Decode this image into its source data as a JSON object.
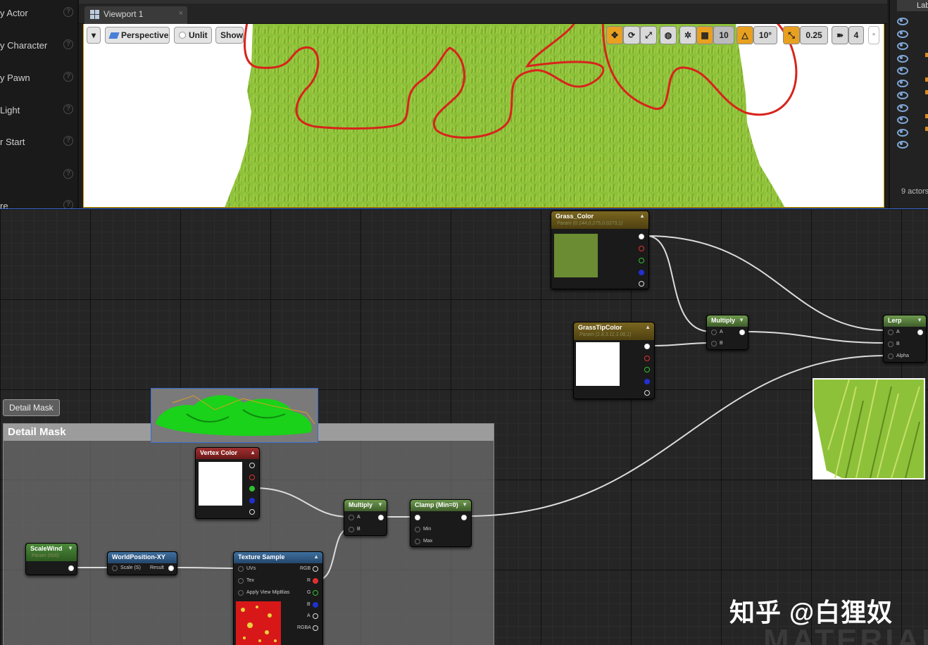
{
  "placement_panel": {
    "items": [
      {
        "label": "y Actor"
      },
      {
        "label": "y Character"
      },
      {
        "label": "y Pawn"
      },
      {
        "label": "Light"
      },
      {
        "label": "r Start"
      },
      {
        "label": ""
      },
      {
        "label": "re"
      }
    ],
    "help_glyph": "?"
  },
  "viewport_tab": {
    "label": "Viewport 1",
    "close_glyph": "×"
  },
  "viewport_toolbar": {
    "menu_glyph": "▾",
    "perspective": "Perspective",
    "unlit": "Unlit",
    "show": "Show",
    "grid_snap": "10",
    "rotation_snap": "10°",
    "scale_snap": "0.25",
    "camera_speed": "4"
  },
  "outliner": {
    "header": "Label",
    "actor_count": "9 actors"
  },
  "graph": {
    "comment": {
      "title": "Detail Mask",
      "bubble": "Detail Mask"
    },
    "nodes": {
      "grass_color": {
        "title": "Grass_Color",
        "subtitle": "Param (0.144,0.275,0.0273,1)",
        "swatch_color": "#6b8c33"
      },
      "grass_tip_color": {
        "title": "GrassTipColor",
        "subtitle": "Param (1.8,3.11,1.08,1)",
        "swatch_color": "#ffffff"
      },
      "multiply_top": {
        "title": "Multiply",
        "pin_a": "A",
        "pin_b": "B"
      },
      "lerp": {
        "title": "Lerp",
        "pin_a": "A",
        "pin_b": "B",
        "pin_alpha": "Alpha"
      },
      "vertex_color": {
        "title": "Vertex Color",
        "swatch_color": "#ffffff"
      },
      "multiply_bottom": {
        "title": "Multiply",
        "pin_a": "A",
        "pin_b": "B"
      },
      "clamp": {
        "title": "Clamp (Min=0)",
        "pin_min": "Min",
        "pin_max": "Max"
      },
      "scale_wind": {
        "title": "ScaleWind",
        "subtitle": "Param (600)"
      },
      "world_position": {
        "title": "WorldPosition-XY",
        "pin_scale": "Scale (S)",
        "pin_result": "Result"
      },
      "texture_sample": {
        "title": "Texture Sample",
        "pin_uvs": "UVs",
        "pin_tex": "Tex",
        "pin_mip": "Apply View MipBias",
        "out_rgb": "RGB",
        "out_r": "R",
        "out_g": "G",
        "out_b": "B",
        "out_a": "A",
        "out_rgba": "RGBA"
      }
    }
  },
  "colors": {
    "grass": "#8ec13a",
    "annotation_red": "#d8231c",
    "accent_orange": "#e8a020"
  },
  "watermark": "知乎 @白狸奴",
  "background_text": "MATERIAL"
}
